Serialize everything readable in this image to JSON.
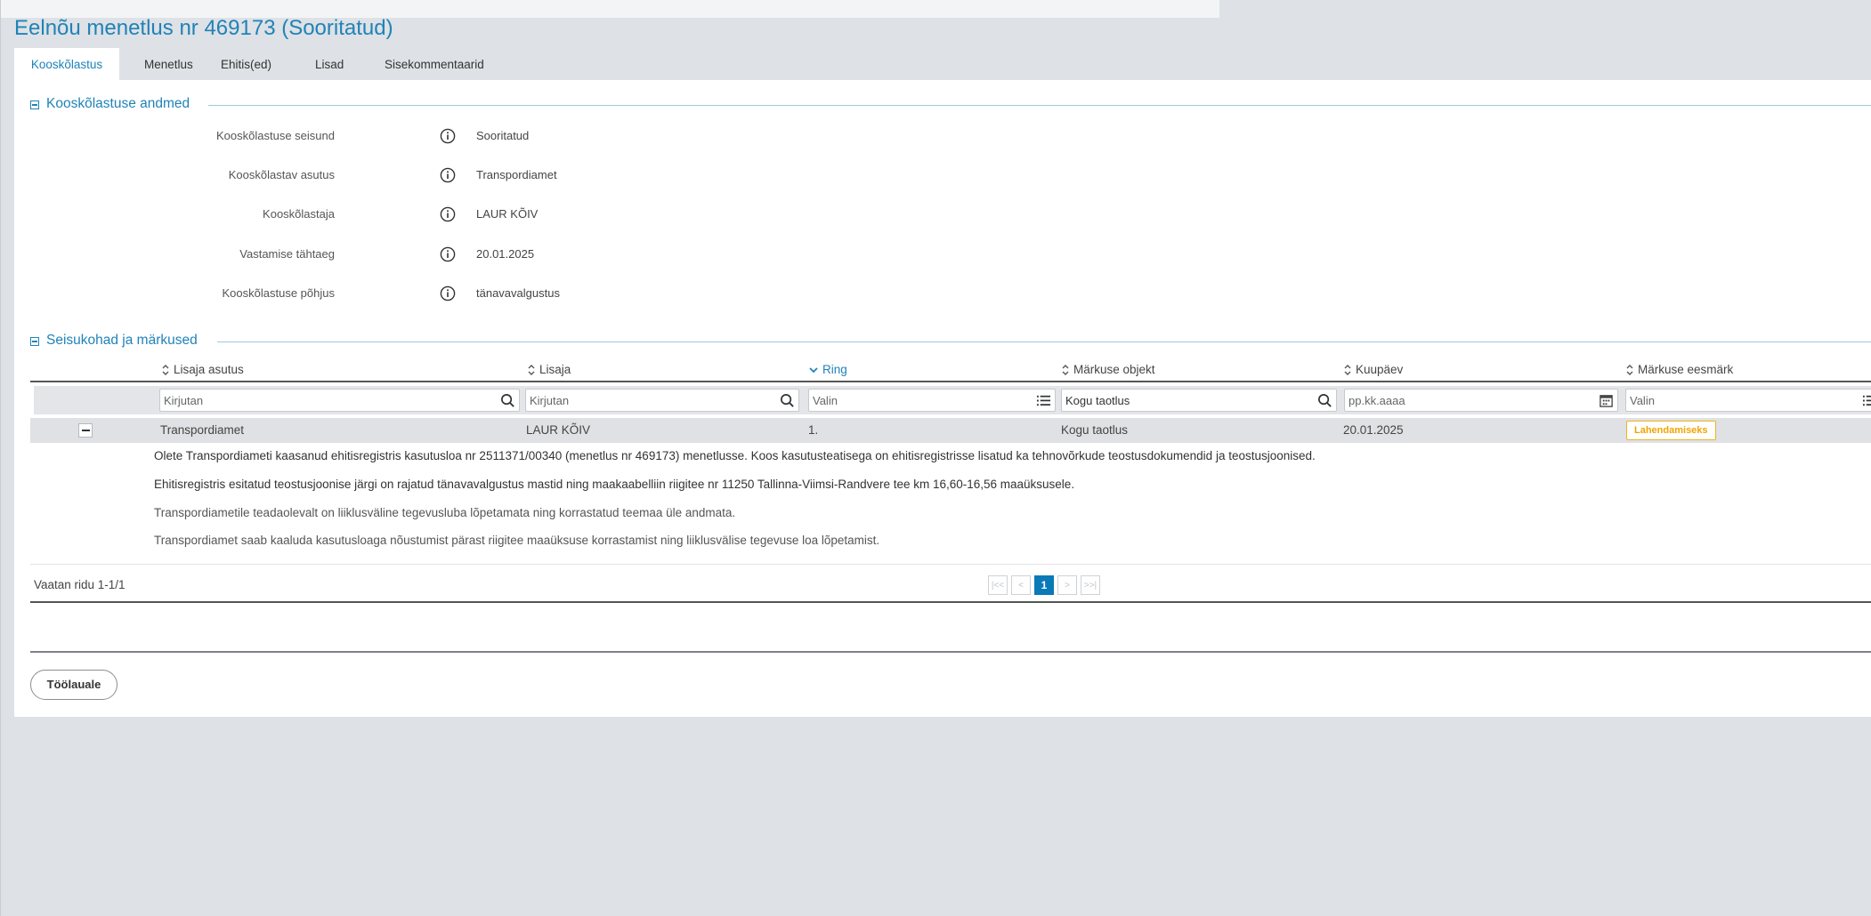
{
  "title": "Eelnõu menetlus nr 469173 (Sooritatud)",
  "tabs": [
    {
      "label": "Kooskõlastus",
      "active": true
    },
    {
      "label": "Menetlus"
    },
    {
      "label": "Ehitis(ed)"
    },
    {
      "label": "Lisad"
    },
    {
      "label": "Sisekommentaarid"
    }
  ],
  "section1": {
    "title": "Kooskõlastuse andmed",
    "fields": [
      {
        "label": "Kooskõlastuse seisund",
        "value": "Sooritatud"
      },
      {
        "label": "Kooskõlastav asutus",
        "value": "Transpordiamet"
      },
      {
        "label": "Kooskõlastaja",
        "value": "LAUR KÕIV"
      },
      {
        "label": "Vastamise tähtaeg",
        "value": "20.01.2025"
      },
      {
        "label": "Kooskõlastuse põhjus",
        "value": "tänavavalgustus"
      }
    ]
  },
  "section2": {
    "title": "Seisukohad ja märkused",
    "columns": [
      "Lisaja asutus",
      "Lisaja",
      "Ring",
      "Märkuse objekt",
      "Kuupäev",
      "Märkuse eesmärk"
    ],
    "filters": {
      "asutus": {
        "placeholder": "Kirjutan",
        "value": ""
      },
      "lisaja": {
        "placeholder": "Kirjutan",
        "value": ""
      },
      "ring": {
        "placeholder": "Valin",
        "value": ""
      },
      "objekt": {
        "placeholder": "Kirjutan",
        "value": "Kogu taotlus"
      },
      "kuupaev": {
        "placeholder": "pp.kk.aaaa",
        "value": ""
      },
      "eesmark": {
        "placeholder": "Valin",
        "value": ""
      }
    },
    "row": {
      "asutus": "Transpordiamet",
      "lisaja": "LAUR KÕIV",
      "ring": "1.",
      "objekt": "Kogu taotlus",
      "kuupaev": "20.01.2025",
      "eesmark": "Lahendamiseks"
    },
    "details": [
      "Olete Transpordiameti kaasanud ehitisregistris kasutusloa nr 2511371/00340 (menetlus nr 469173) menetlusse. Koos kasutusteatisega on ehitisregistrisse lisatud ka tehnovõrkude teostusdokumendid ja teostusjoonised.",
      "Ehitisregistris esitatud teostusjoonise järgi on rajatud tänavavalgustus mastid ning maakaabelliin riigitee nr 11250 Tallinna-Viimsi-Randvere tee km 16,60-16,56 maaüksusele.",
      "Transpordiametile teadaolevalt on liiklusväline tegevusluba lõpetamata ning korrastatud teemaa üle andmata.",
      "Transpordiamet saab kaaluda kasutusloaga nõustumist pärast riigitee maaüksuse korrastamist ning liiklusvälise tegevuse loa lõpetamist."
    ],
    "row_count": "Vaatan ridu 1-1/1",
    "pager": {
      "first": "|<<",
      "prev": "<",
      "current": "1",
      "next": ">",
      "last": ">>|"
    }
  },
  "back_button": "Töölauale",
  "colors": {
    "accent": "#1f83b8",
    "badge": "#f0b323",
    "page_current": "#0a79b8"
  }
}
